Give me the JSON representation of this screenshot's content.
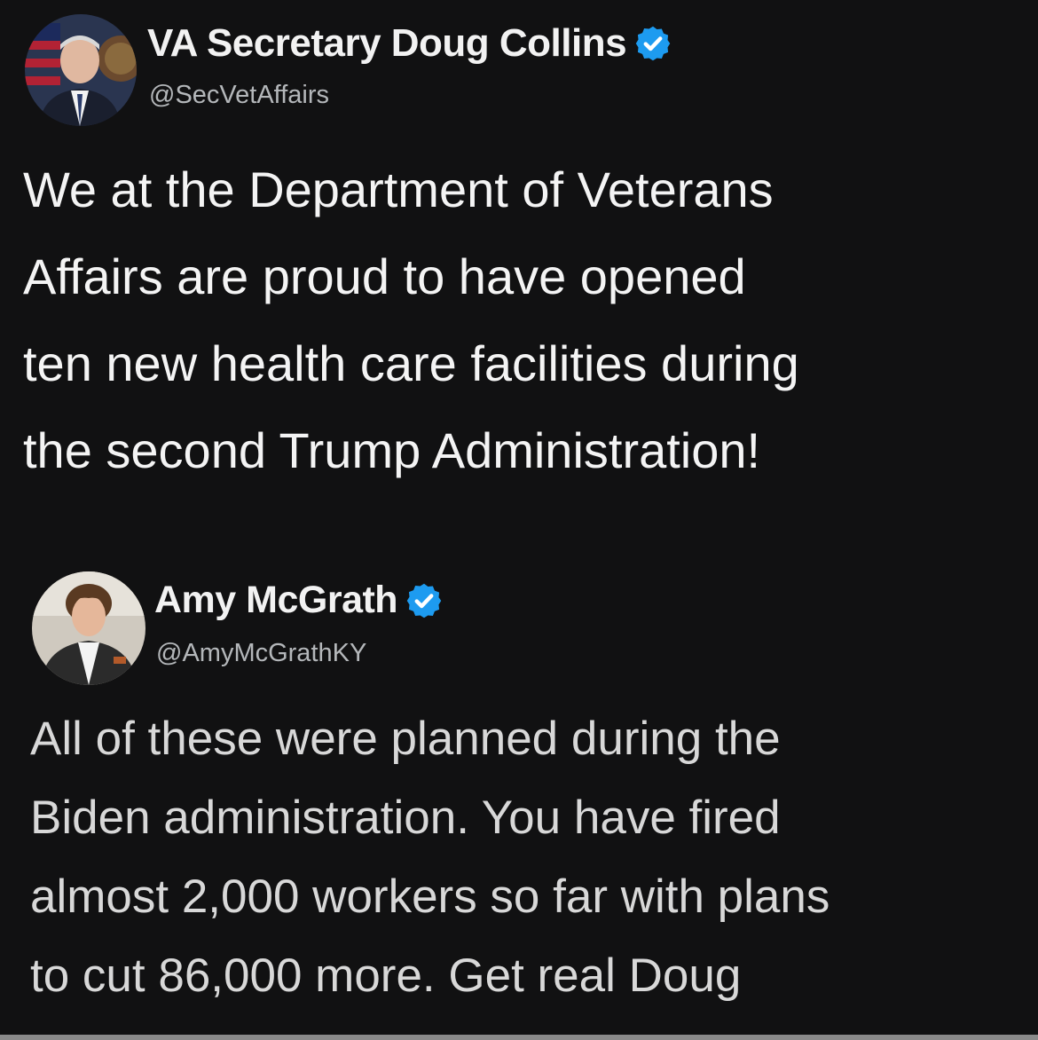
{
  "tweets": [
    {
      "display_name": "VA Secretary Doug Collins",
      "handle": "@SecVetAffairs",
      "verified": true,
      "lines": [
        "We at the Department of Veterans",
        "Affairs are proud to have opened",
        "ten new health care facilities during",
        "the second Trump Administration!"
      ]
    },
    {
      "display_name": "Amy McGrath",
      "handle": "@AmyMcGrathKY",
      "verified": true,
      "lines": [
        "All of these were planned during the",
        "Biden administration. You have fired",
        "almost 2,000 workers so far with plans",
        "to cut 86,000 more. Get real Doug"
      ]
    }
  ],
  "colors": {
    "background": "#111112",
    "verified_badge": "#1d9bf0",
    "handle": "#b4b7ba"
  },
  "icons": {
    "verified": "verified-badge-icon"
  }
}
